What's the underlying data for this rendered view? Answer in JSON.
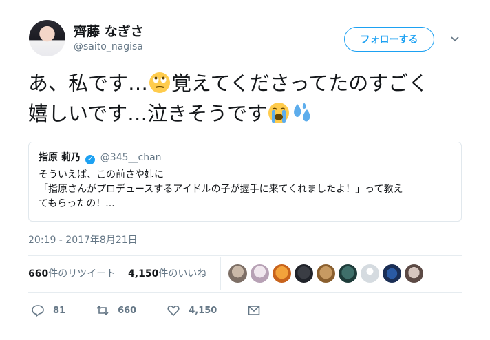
{
  "user": {
    "display_name": "齊藤 なぎさ",
    "handle": "@saito_nagisa",
    "follow_label": "フォローする"
  },
  "tweet": {
    "line1_text": "あ、私です…",
    "line1_emoji": "rolling-eyes-emoji",
    "line1_text_after": "覚えてくださってたのすごく",
    "line2_text": "嬉しいです…泣きそうです",
    "line2_emojis": [
      "loudly-crying-emoji",
      "sweat-droplets-emoji"
    ]
  },
  "quote": {
    "name": "指原 莉乃",
    "handle": "@345__chan",
    "verified_icon": "verified-badge-icon",
    "line1": "そういえば、この前さや姉に",
    "line2": "「指原さんがプロデュースするアイドルの子が握手に来てくれましたよ！」って教え",
    "line3": "てもらったの！..."
  },
  "timestamp": "20:19 - 2017年8月21日",
  "stats": {
    "retweets_count": "660",
    "retweets_label": "件のリツイート",
    "likes_count": "4,150",
    "likes_label": "件のいいね"
  },
  "actions": {
    "reply_count": "81",
    "retweet_count": "660",
    "like_count": "4,150"
  },
  "colors": {
    "accent": "#1da1f2",
    "muted": "#657786",
    "text": "#14171a"
  }
}
